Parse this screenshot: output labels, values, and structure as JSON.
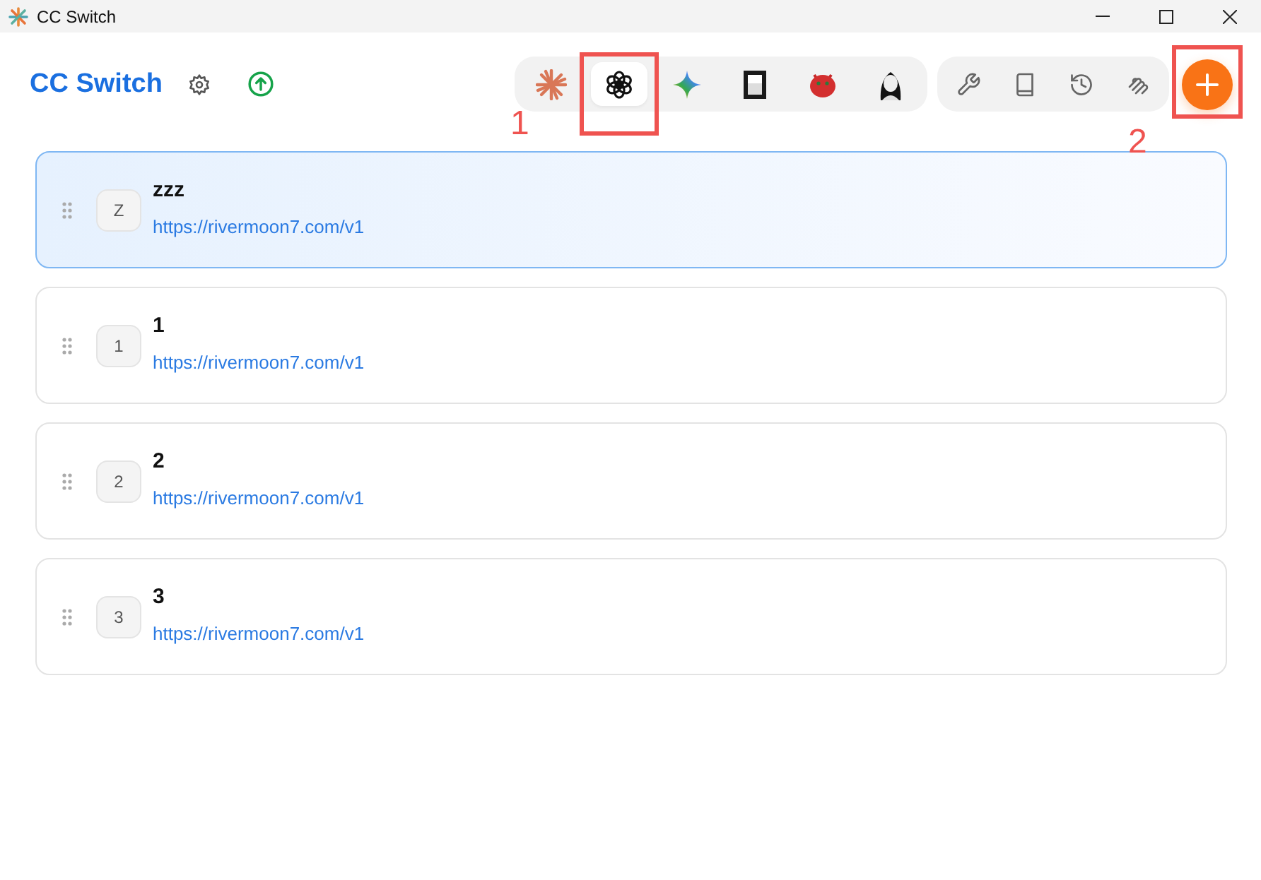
{
  "window": {
    "title": "CC Switch"
  },
  "header": {
    "title": "CC Switch"
  },
  "apps": [
    {
      "kind": "burst",
      "selected": false
    },
    {
      "kind": "knot",
      "selected": true
    },
    {
      "kind": "sparkle",
      "selected": false
    },
    {
      "kind": "square",
      "selected": false
    },
    {
      "kind": "creature",
      "selected": false
    },
    {
      "kind": "figure",
      "selected": false
    }
  ],
  "tools": [
    {
      "kind": "wrench"
    },
    {
      "kind": "book"
    },
    {
      "kind": "history"
    },
    {
      "kind": "coil"
    }
  ],
  "providers": [
    {
      "badge": "Z",
      "name": "zzz",
      "url": "https://rivermoon7.com/v1",
      "selected": true
    },
    {
      "badge": "1",
      "name": "1",
      "url": "https://rivermoon7.com/v1",
      "selected": false
    },
    {
      "badge": "2",
      "name": "2",
      "url": "https://rivermoon7.com/v1",
      "selected": false
    },
    {
      "badge": "3",
      "name": "3",
      "url": "https://rivermoon7.com/v1",
      "selected": false
    }
  ],
  "annotations": [
    {
      "label": "1",
      "kind": "tab"
    },
    {
      "label": "2",
      "kind": "add"
    }
  ]
}
